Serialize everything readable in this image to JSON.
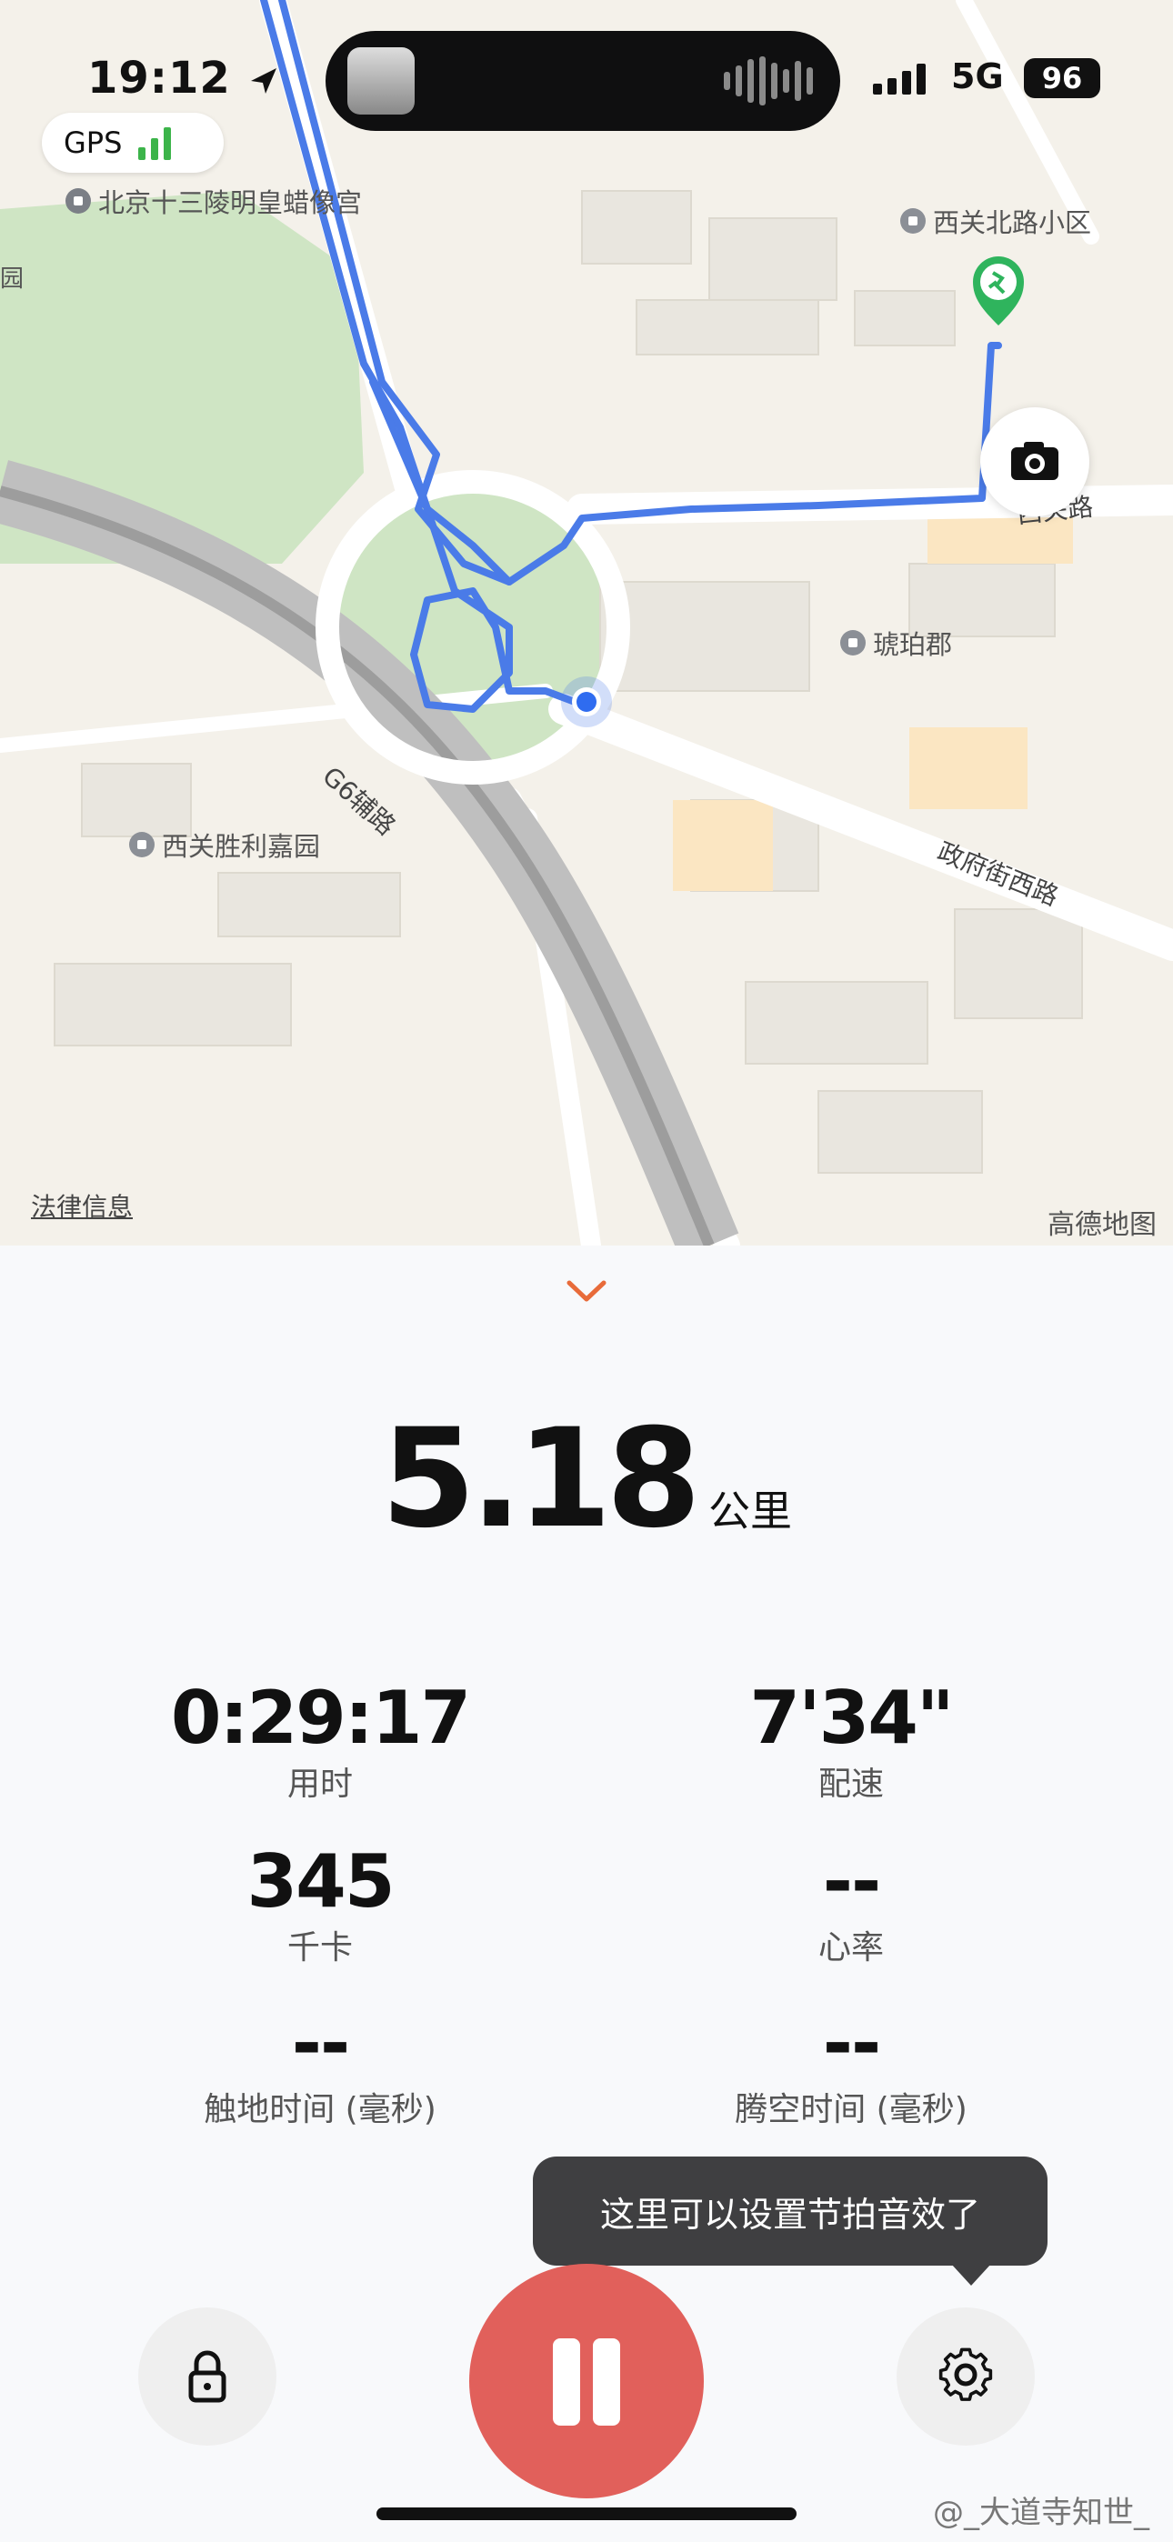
{
  "status_bar": {
    "time": "19:12",
    "network": "5G",
    "battery": "96"
  },
  "gps": {
    "label": "GPS"
  },
  "map": {
    "poi": [
      "北京十三陵明皇蜡像宫",
      "西关北路小区",
      "琥珀郡",
      "西关胜利嘉园"
    ],
    "roads": [
      "西关路",
      "G6辅路",
      "政府街西路"
    ],
    "legal_link": "法律信息",
    "provider": "高德地图",
    "edge_label": "园"
  },
  "workout": {
    "distance_value": "5.18",
    "distance_unit": "公里",
    "metrics": [
      {
        "value": "0:29:17",
        "label": "用时"
      },
      {
        "value": "7'34\"",
        "label": "配速"
      },
      {
        "value": "345",
        "label": "千卡"
      },
      {
        "value": "--",
        "label": "心率"
      },
      {
        "value": "--",
        "label": "触地时间 (毫秒)"
      },
      {
        "value": "--",
        "label": "腾空时间 (毫秒)"
      }
    ]
  },
  "tooltip": "这里可以设置节拍音效了",
  "watermark": "@_大道寺知世_",
  "colors": {
    "route": "#4a7be8",
    "pause": "#e1605b",
    "accent_chevron": "#e86b3a",
    "gps_green": "#3cb44a"
  }
}
